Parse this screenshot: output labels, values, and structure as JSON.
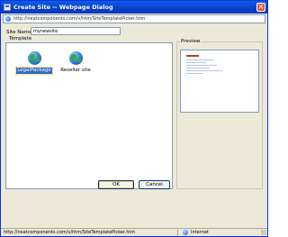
{
  "window": {
    "title": "Create Site -- Webpage Dialog",
    "close_glyph": "×"
  },
  "address_bar": {
    "url": "http://neatcomponents.com/v/htm/SiteTemplatePicker.htm",
    "icon": "ie-page-icon"
  },
  "form": {
    "site_name_label": "Site Name",
    "site_name_value": "mynewsite",
    "template_label": "Template",
    "preview_label": "Preview"
  },
  "templates": [
    {
      "label": "LegalPackage",
      "icon": "globe-icon",
      "selected": true
    },
    {
      "label": "Reseller site",
      "icon": "globe-icon",
      "selected": false
    }
  ],
  "buttons": {
    "ok_label": "OK",
    "cancel_label": "Cancel"
  },
  "status_bar": {
    "url": "http://neatcomponents.com/v/htm/SiteTemplatePicker.htm",
    "zone": "Internet",
    "zone_icon": "internet-zone-icon"
  },
  "colors": {
    "titlebar": "#0a3fc9",
    "selection": "#316ac5",
    "dialog_bg": "#ece9d8"
  }
}
